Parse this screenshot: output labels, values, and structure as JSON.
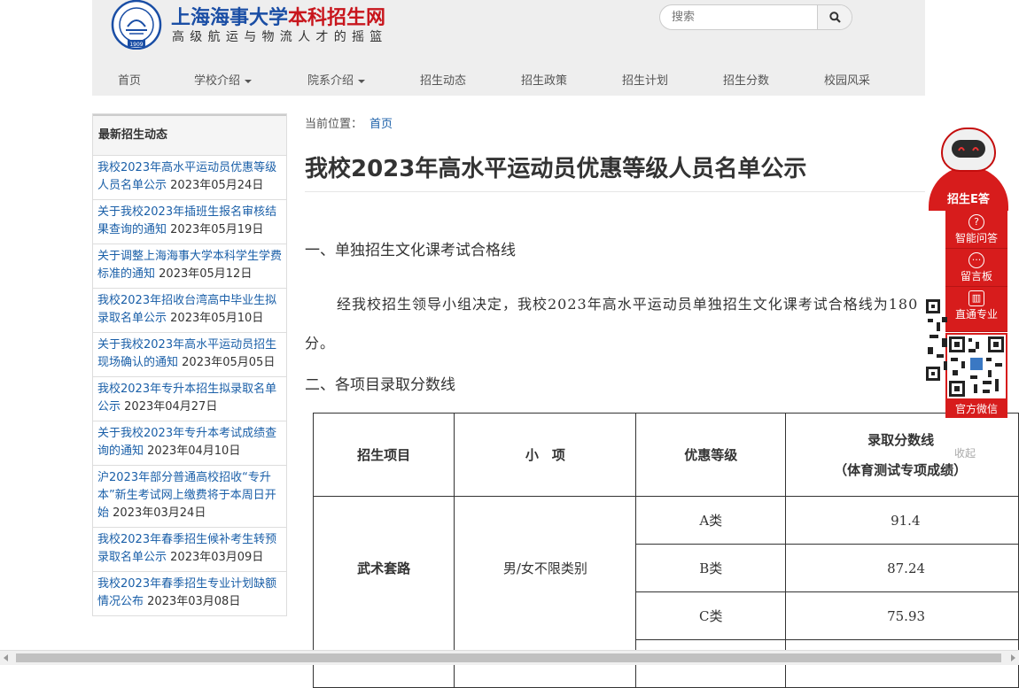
{
  "header": {
    "logo_title_a": "上海海事大学",
    "logo_title_b": "本科招生网",
    "logo_subtitle": "高级航运与物流人才的摇篮",
    "seal_year": "1909",
    "search": {
      "placeholder": "搜索"
    }
  },
  "nav": {
    "items": [
      {
        "label": "首页"
      },
      {
        "label": "学校介绍"
      },
      {
        "label": "院系介绍"
      },
      {
        "label": "招生动态"
      },
      {
        "label": "招生政策"
      },
      {
        "label": "招生计划"
      },
      {
        "label": "招生分数"
      },
      {
        "label": "校园风采"
      }
    ]
  },
  "sidebar": {
    "title": "最新招生动态",
    "items": [
      {
        "text": "我校2023年高水平运动员优惠等级人员名单公示",
        "date": "2023年05月24日"
      },
      {
        "text": "关于我校2023年插班生报名审核结果查询的通知",
        "date": "2023年05月19日"
      },
      {
        "text": "关于调整上海海事大学本科学生学费标准的通知",
        "date": "2023年05月12日"
      },
      {
        "text": "我校2023年招收台湾高中毕业生拟录取名单公示",
        "date": "2023年05月10日"
      },
      {
        "text": "关于我校2023年高水平运动员招生现场确认的通知",
        "date": "2023年05月05日"
      },
      {
        "text": "我校2023年专升本招生拟录取名单公示",
        "date": "2023年04月27日"
      },
      {
        "text": "关于我校2023年专升本考试成绩查询的通知",
        "date": "2023年04月10日"
      },
      {
        "text": "沪2023年部分普通高校招收“专升本”新生考试网上缴费将于本周日开始",
        "date": "2023年03月24日"
      },
      {
        "text": "我校2023年春季招生候补考生转预录取名单公示",
        "date": "2023年03月09日"
      },
      {
        "text": "我校2023年春季招生专业计划缺额情况公布",
        "date": "2023年03月08日"
      }
    ]
  },
  "article": {
    "breadcrumb_label": "当前位置：",
    "breadcrumb_link": "首页",
    "title": "我校2023年高水平运动员优惠等级人员名单公示",
    "section1": "一、单独招生文化课考试合格线",
    "para1": "经我校招生领导小组决定，我校2023年高水平运动员单独招生文化课考试合格线为180分。",
    "section2": "二、各项目录取分数线",
    "table": {
      "headers": [
        "招生项目",
        "小　项",
        "优惠等级",
        "录取分数线",
        "（体育测试专项成绩）"
      ],
      "project": "武术套路",
      "sub": "男/女不限类别",
      "rows": [
        {
          "level": "A类",
          "score": "91.4"
        },
        {
          "level": "B类",
          "score": "87.24"
        },
        {
          "level": "C类",
          "score": "75.93"
        }
      ]
    }
  },
  "float_panel": {
    "robot_label": "招生E答",
    "buttons": [
      {
        "label": "智能问答"
      },
      {
        "label": "留言板"
      },
      {
        "label": "直通专业"
      }
    ],
    "wechat_label": "官方微信",
    "collapse_label": "收起"
  },
  "colors": {
    "brand_blue": "#1a4ea5",
    "brand_red": "#c8161d",
    "link": "#1a5fa8",
    "panel_red": "#d71c1c"
  }
}
